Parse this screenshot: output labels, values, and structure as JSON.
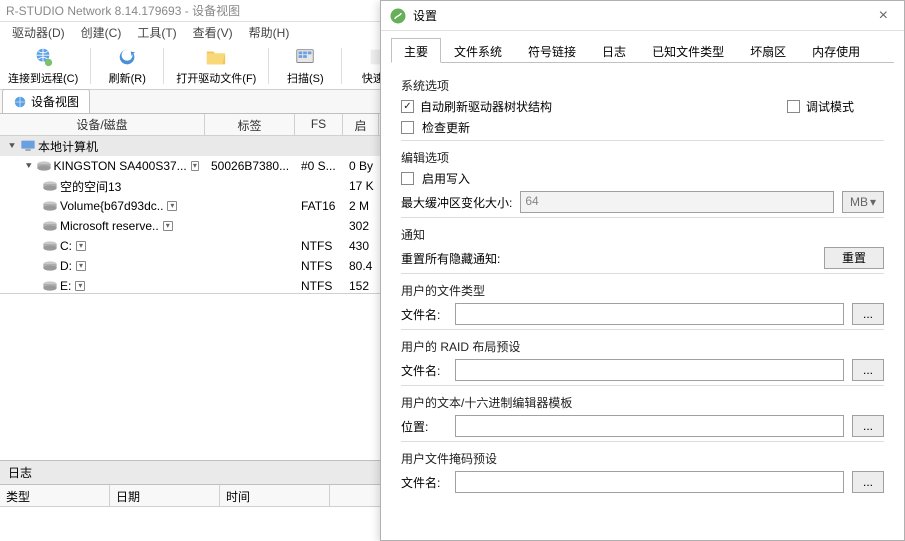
{
  "window": {
    "title": "R-STUDIO Network 8.14.179693 - 设备视图"
  },
  "menu": {
    "drives": "驱动器(D)",
    "create": "创建(C)",
    "tools": "工具(T)",
    "view": "查看(V)",
    "help": "帮助(H)"
  },
  "toolbar": {
    "connect": "连接到远程(C)",
    "refresh": "刷新(R)",
    "open": "打开驱动文件(F)",
    "scan": "扫描(S)",
    "quick": "快速分"
  },
  "viewtab": {
    "label": "设备视图"
  },
  "grid": {
    "headers": {
      "device": "设备/磁盘",
      "label": "标签",
      "fs": "FS",
      "start": "启"
    },
    "root": {
      "label": "本地计算机"
    },
    "rows": [
      {
        "indent": 1,
        "name": "KINGSTON SA400S37...",
        "label": "50026B7380...",
        "fs": "#0 S...",
        "start": "0 By",
        "dd": true
      },
      {
        "indent": 2,
        "name": "空的空间13",
        "label": "",
        "fs": "",
        "start": "17 K"
      },
      {
        "indent": 2,
        "name": "Volume{b67d93dc..",
        "label": "",
        "fs": "FAT16",
        "start": "2 M",
        "dd": true
      },
      {
        "indent": 2,
        "name": "Microsoft reserve..",
        "label": "",
        "fs": "",
        "start": "302",
        "dd": true
      },
      {
        "indent": 2,
        "name": "C:",
        "label": "",
        "fs": "NTFS",
        "start": "430",
        "dd": true
      },
      {
        "indent": 2,
        "name": "D:",
        "label": "",
        "fs": "NTFS",
        "start": "80.4",
        "dd": true
      },
      {
        "indent": 2,
        "name": "E:",
        "label": "",
        "fs": "NTFS",
        "start": "152",
        "dd": true
      }
    ]
  },
  "log": {
    "title": "日志",
    "cols": {
      "type": "类型",
      "date": "日期",
      "time": "时间"
    }
  },
  "dlg": {
    "title": "设置",
    "tabs": {
      "main": "主要",
      "fs": "文件系统",
      "sym": "符号链接",
      "log": "日志",
      "known": "已知文件类型",
      "bad": "坏扇区",
      "mem": "内存使用"
    },
    "sys_options": "系统选项",
    "auto_refresh": "自动刷新驱动器树状结构",
    "debug": "调试模式",
    "check_update": "检查更新",
    "edit_options": "编辑选项",
    "enable_write": "启用写入",
    "max_buf_label": "最大缓冲区变化大小:",
    "max_buf_value": "64",
    "unit": "MB",
    "notify": "通知",
    "reset_hidden": "重置所有隐藏通知:",
    "reset": "重置",
    "user_filetypes": "用户的文件类型",
    "filename": "文件名:",
    "user_raid": "用户的 RAID 布局预设",
    "user_hex": "用户的文本/十六进制编辑器模板",
    "location": "位置:",
    "user_mask": "用户文件掩码预设",
    "browse": "..."
  }
}
